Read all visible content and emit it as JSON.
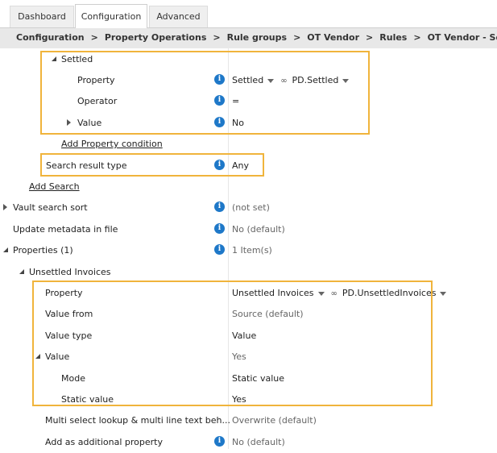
{
  "tabs": [
    "Dashboard",
    "Configuration",
    "Advanced"
  ],
  "breadcrumb": [
    "Configuration",
    "Property Operations",
    "Rule groups",
    "OT Vendor",
    "Rules",
    "OT Vendor - Set Unsettled Invoices"
  ],
  "breadcrumb_sep": ">",
  "settled": {
    "label": "Settled",
    "property_label": "Property",
    "property_value": "Settled",
    "property_alias": "PD.Settled",
    "operator_label": "Operator",
    "operator_value": "=",
    "value_label": "Value",
    "value_value": "No"
  },
  "add_property_condition": "Add Property condition",
  "search_result": {
    "label": "Search result type",
    "value": "Any"
  },
  "add_search": "Add Search",
  "vault_sort": {
    "label": "Vault search sort",
    "value": "(not set)"
  },
  "update_metadata": {
    "label": "Update metadata in file",
    "value": "No (default)"
  },
  "properties": {
    "label": "Properties (1)",
    "value": "1 Item(s)"
  },
  "unsettled": {
    "label": "Unsettled Invoices",
    "property_label": "Property",
    "property_value": "Unsettled Invoices",
    "property_alias": "PD.UnsettledInvoices",
    "value_from_label": "Value from",
    "value_from_value": "Source (default)",
    "value_type_label": "Value type",
    "value_type_value": "Value",
    "value_label": "Value",
    "value_value": "Yes",
    "mode_label": "Mode",
    "mode_value": "Static value",
    "static_label": "Static value",
    "static_value": "Yes"
  },
  "multi_select": {
    "label": "Multi select lookup & multi line text beh...",
    "value": "Overwrite (default)"
  },
  "add_additional": {
    "label": "Add as additional property",
    "value": "No (default)"
  },
  "icons": {
    "info": "i",
    "chain": "∞"
  },
  "colors": {
    "highlight": "#f0b43c",
    "info": "#1e78c8"
  }
}
